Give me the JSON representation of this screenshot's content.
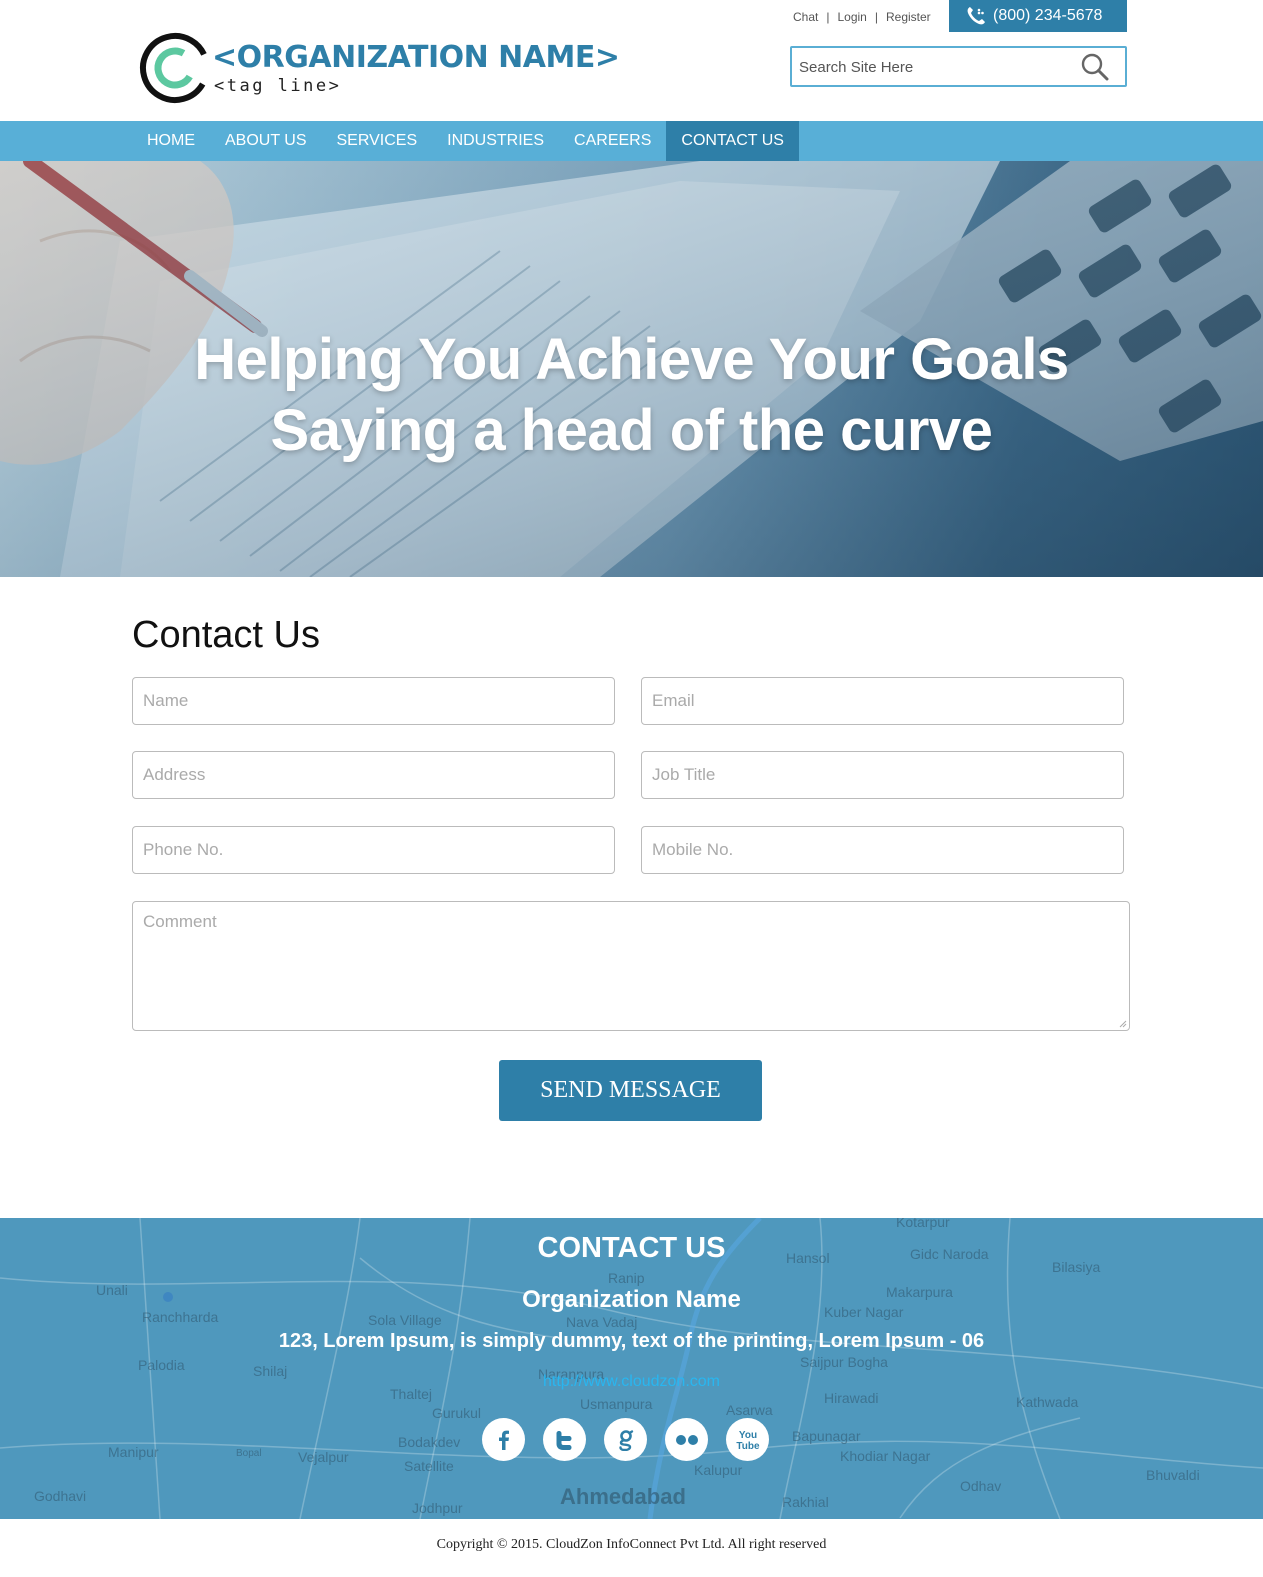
{
  "header": {
    "org_name": "<ORGANIZATION NAME>",
    "tag_line": "<tag line>",
    "top_links": [
      "Chat",
      "Login",
      "Register"
    ],
    "phone": "(800) 234-5678",
    "search_placeholder": "Search Site Here"
  },
  "nav": {
    "items": [
      {
        "label": "HOME"
      },
      {
        "label": "ABOUT US"
      },
      {
        "label": "SERVICES"
      },
      {
        "label": "INDUSTRIES"
      },
      {
        "label": "CAREERS"
      },
      {
        "label": "CONTACT US"
      }
    ],
    "active": "CONTACT US"
  },
  "hero": {
    "line1": "Helping You Achieve Your Goals",
    "line2": "Saying a head of the curve"
  },
  "contact": {
    "heading": "Contact Us",
    "fields": {
      "name": "Name",
      "email": "Email",
      "address": "Address",
      "job_title": "Job Title",
      "phone": "Phone No.",
      "mobile": "Mobile No.",
      "comment": "Comment"
    },
    "submit_label": "SEND MESSAGE"
  },
  "footer": {
    "title": "CONTACT US",
    "org": "Organization Name",
    "address": "123, Lorem Ipsum, is simply dummy, text of the printing, Lorem Ipsum - 06",
    "url": "http://www.cloudzon.com",
    "socials": [
      "facebook-icon",
      "twitter-icon",
      "google-icon",
      "flickr-icon",
      "youtube-icon"
    ],
    "youtube_text_top": "You",
    "youtube_text_bottom": "Tube",
    "map_labels": {
      "city": "Ahmedabad",
      "places": [
        "Unali",
        "Ranchharda",
        "Palodia",
        "Shilaj",
        "Manipur",
        "Godhavi",
        "Vejalpur",
        "Bopal",
        "Thaltej",
        "Gurukul",
        "Bodakdev",
        "Satellite",
        "Jodhpur",
        "Sola Village",
        "Ranip",
        "Nava Vadaj",
        "Naranpura",
        "Usmanpura",
        "Hansol",
        "Gidc Naroda",
        "Makarpura",
        "Kuber Nagar",
        "Saijpur Bogha",
        "Hirawadi",
        "Bapunagar",
        "Khodiar Nagar",
        "Asarwa",
        "Kathwada",
        "Bilasiya",
        "Bhuvaldi",
        "Odhav",
        "Rakhial",
        "Kalupur",
        "Kotarpur"
      ]
    }
  },
  "copyright": "Copyright © 2015. CloudZon InfoConnect Pvt Ltd. All right reserved",
  "colors": {
    "brand_dark": "#2e7fa8",
    "brand_light": "#58afd7",
    "logo_green": "#5cc8a0",
    "link_blue": "#29b6f0"
  }
}
